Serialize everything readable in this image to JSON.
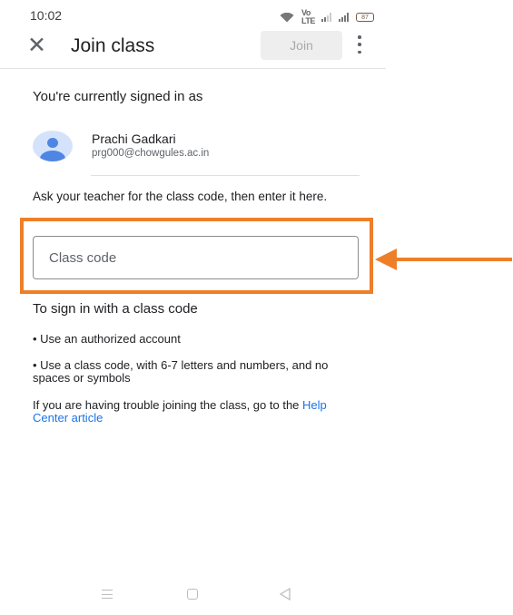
{
  "status_bar": {
    "time": "10:02",
    "volte": "Vo\nLTE",
    "battery": "87"
  },
  "app_bar": {
    "title": "Join class",
    "join_label": "Join",
    "close_icon": "close-icon",
    "more_icon": "more-vert-icon"
  },
  "account": {
    "heading": "You're currently signed in as",
    "name": "Prachi Gadkari",
    "email": "prg000@chowgules.ac.in"
  },
  "instructions": "Ask your teacher for the class code, then enter it here.",
  "class_code": {
    "placeholder": "Class code",
    "value": ""
  },
  "sign_in_help": {
    "heading": "To sign in with a class code",
    "rules": [
      "• Use an authorized account",
      "• Use a class code, with 6-7 letters and numbers, and no spaces or symbols"
    ],
    "trouble_text": "If you are having trouble joining the class, go to the",
    "help_link": "Help Center article"
  },
  "annotation": {
    "highlight_color": "#ee7f29",
    "arrow_color": "#ee7f29"
  },
  "nav_bar": [
    "menu-icon",
    "home-icon",
    "back-icon"
  ]
}
